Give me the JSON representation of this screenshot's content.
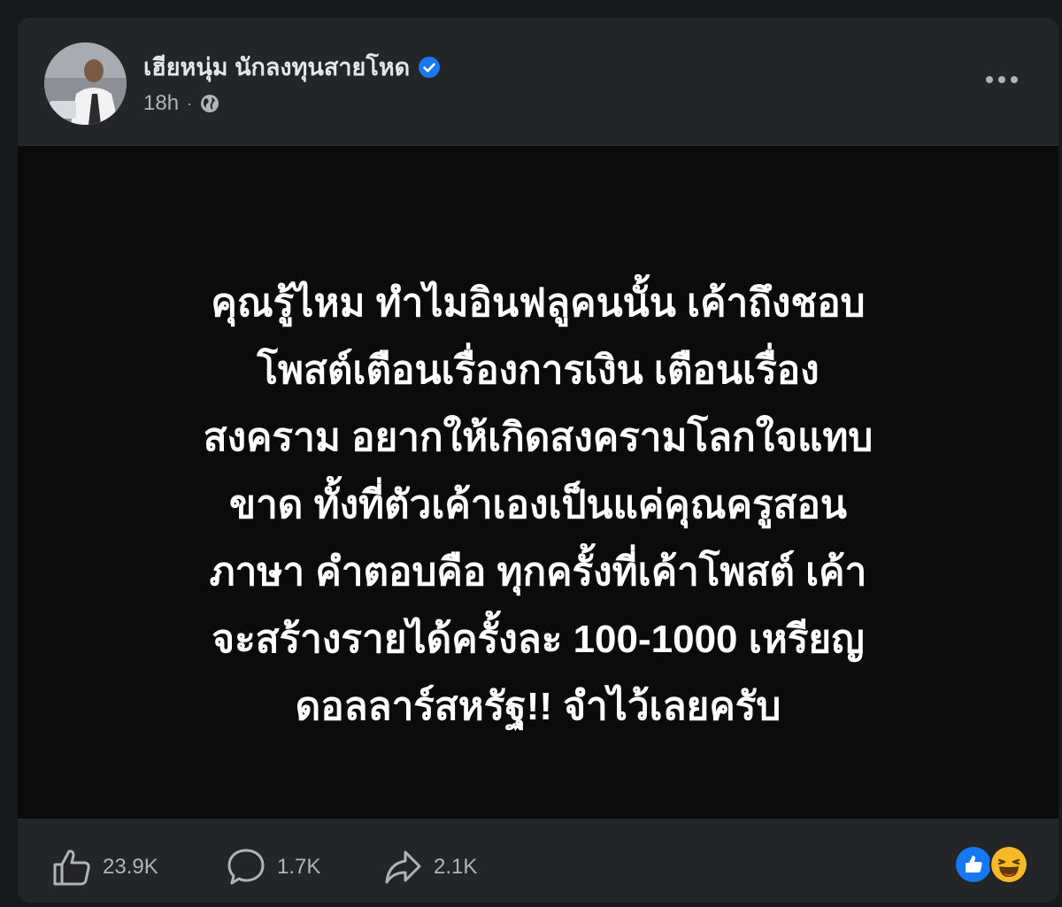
{
  "post": {
    "author": "เฮียหนุ่ม นักลงทุนสายโหด",
    "timestamp": "18h",
    "privacy_icon": "globe-icon",
    "verified_color": "#1877f2",
    "text_lines": [
      "คุณรู้ไหม ทำไมอินฟลูคนนั้น เค้าถึงชอบ",
      "โพสต์เตือนเรื่องการเงิน เตือนเรื่อง",
      "สงคราม อยากให้เกิดสงครามโลกใจแทบ",
      "ขาด ทั้งที่ตัวเค้าเองเป็นแค่คุณครูสอน",
      "ภาษา คำตอบคือ ทุกครั้งที่เค้าโพสต์ เค้า",
      "จะสร้างรายได้ครั้งละ 100-1000 เหรียญ",
      "ดอลลาร์สหรัฐ!! จำไว้เลยครับ"
    ]
  },
  "stats": {
    "likes": "23.9K",
    "comments": "1.7K",
    "shares": "2.1K"
  },
  "reaction_icons": [
    "like-reaction-icon",
    "haha-reaction-icon"
  ],
  "colors": {
    "background": "#18191a",
    "card": "#242526",
    "content_bg": "#0b0b0b",
    "text_secondary": "#b0b3b8"
  }
}
